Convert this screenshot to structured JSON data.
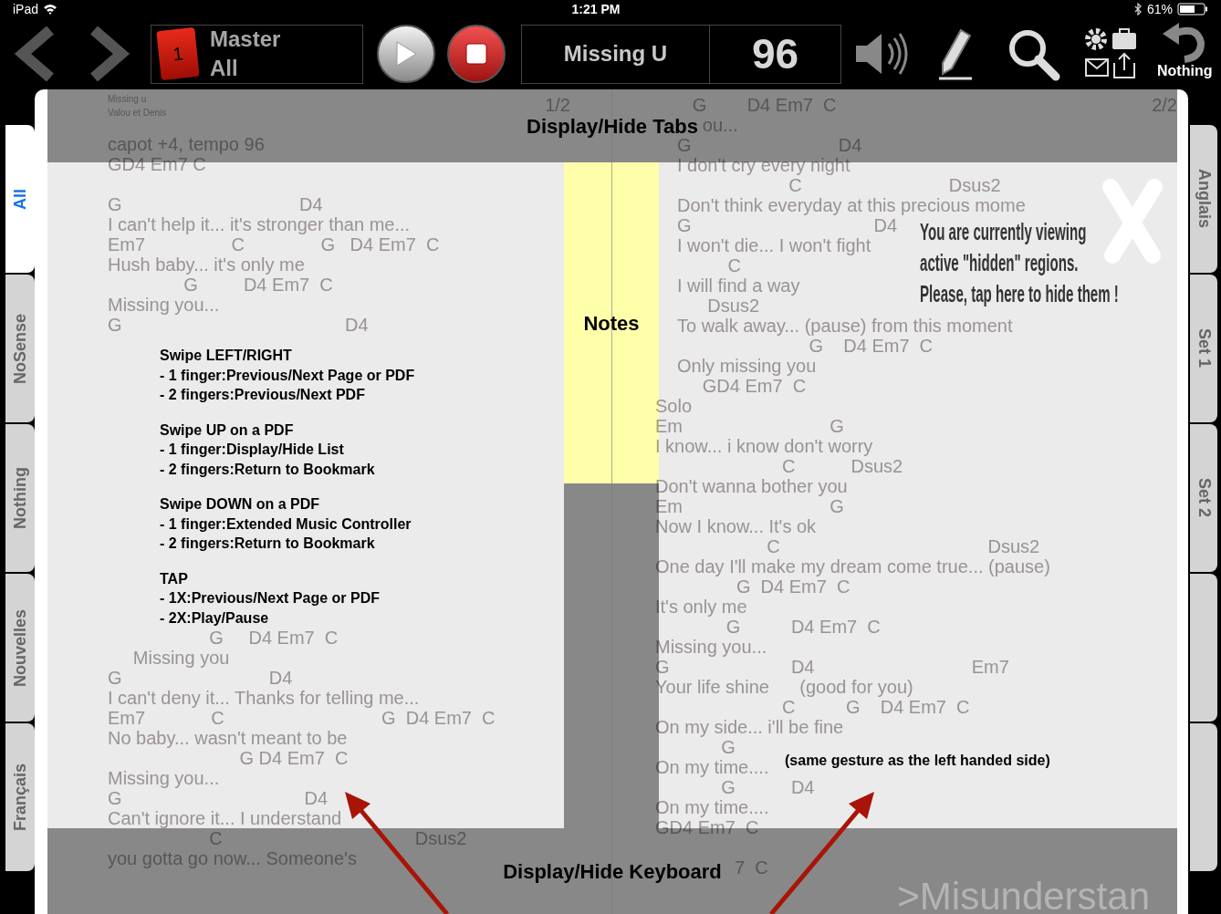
{
  "status_bar": {
    "carrier": "iPad",
    "time": "1:21 PM",
    "battery": "61%"
  },
  "toolbar": {
    "library": {
      "badge": "1",
      "line_1": "Master",
      "line_2": "All"
    },
    "song_title": "Missing U",
    "tempo": "96",
    "undo_label": "Nothing"
  },
  "left_tabs": [
    {
      "label": "All",
      "selected": true
    },
    {
      "label": "NoSense",
      "selected": false
    },
    {
      "label": "Nothing",
      "selected": false
    },
    {
      "label": "Nouvelles",
      "selected": false
    },
    {
      "label": "Français",
      "selected": false
    }
  ],
  "right_tabs": [
    {
      "kind": "label",
      "label": "Anglais",
      "selected": false
    },
    {
      "kind": "label",
      "label": "Set 1",
      "selected": false
    },
    {
      "kind": "label",
      "label": "Set 2",
      "selected": false
    },
    {
      "kind": "blank",
      "selected": false
    },
    {
      "kind": "blank",
      "selected": false
    }
  ],
  "sheet": {
    "song_header": {
      "title": "Missing u",
      "artist": "Valou et Denis"
    },
    "pages": [
      {
        "number": "1/2",
        "stanzas": [
          [
            "capot +4, tempo 96",
            "GD4 Em7 C"
          ],
          [
            "G                                   D4",
            "I can't help it... it's stronger than me...",
            "Em7                 C               G   D4 Em7  C",
            "Hush baby... it's only me",
            "               G         D4 Em7  C",
            "Missing you...",
            "G                                            D4"
          ],
          [
            "                    G     D4 Em7  C",
            "     Missing you",
            "G                             D4",
            "I can't deny it... Thanks for telling me...",
            "Em7             C                               G  D4 Em7  C",
            "No baby... wasn't meant to be",
            "                          G D4 Em7  C",
            "Missing you...",
            "G                                    D4",
            "Can't ignore it... I understand",
            "                    C                                      Dsus2",
            "you gotta go now... Someone's"
          ]
        ]
      },
      {
        "number": "2/2",
        "stanzas": [
          [
            "   G        D4 Em7  C",
            "     ou...",
            "G                             D4",
            "I don't cry every night",
            "                      C                             Dsus2",
            "Don't think everyday at this precious mome",
            "G                                    D4",
            "I won't die... I won't fight",
            "          C",
            "I will find a way",
            "      Dsus2",
            "To walk away... (pause) from this moment",
            "                          G    D4 Em7  C",
            "Only missing you",
            "     GD4 Em7  C"
          ],
          [
            "Solo",
            "Em                             G",
            "I know... i know don't worry",
            "                         C           Dsus2",
            "Don't wanna bother you",
            "Em                             G",
            "Now I know... It's ok",
            "                      C                                         Dsus2",
            "One day I'll make my dream come true... (pause)",
            "                G  D4 Em7  C",
            "It's only me",
            "              G          D4 Em7  C",
            "Missing you...",
            "G                        D4                               Em7",
            "Your life shine      (good for you)",
            "                         C          G    D4 Em7  C",
            "On my side... i'll be fine",
            "             G",
            "On my time....",
            "             G           D4",
            "On my time....",
            "GD4 Em7  C"
          ],
          [
            "7  C"
          ]
        ]
      }
    ],
    "next_song": ">Misunderstan"
  },
  "regions": {
    "top": "Display/Hide Tabs",
    "notes": "Notes",
    "bottom": "Display/Hide Keyboard"
  },
  "gesture_help": [
    {
      "title": "Swipe LEFT/RIGHT",
      "items": [
        "- 1 finger:Previous/Next Page or PDF",
        "- 2 fingers:Previous/Next PDF"
      ]
    },
    {
      "title": "Swipe UP on a PDF",
      "items": [
        "- 1 finger:Display/Hide List",
        "- 2 fingers:Return to Bookmark"
      ]
    },
    {
      "title": "Swipe DOWN on a PDF",
      "items": [
        "- 1 finger:Extended Music Controller",
        "- 2 fingers:Return to Bookmark"
      ]
    },
    {
      "title": "TAP",
      "items": [
        "- 1X:Previous/Next Page or PDF",
        "- 2X:Play/Pause"
      ]
    }
  ],
  "right_help": "(same gesture as the left handed side)",
  "hidden_notice": [
    "You are currently viewing",
    "active \"hidden\" regions.",
    "Please, tap here to hide them !"
  ]
}
